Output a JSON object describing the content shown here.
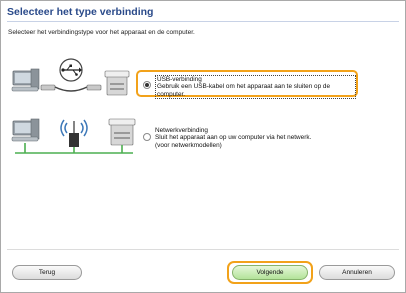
{
  "window": {
    "title": "Selecteer het type verbinding",
    "instruction": "Selecteer het verbindingstype voor het apparaat en de computer."
  },
  "options": [
    {
      "heading": "USB-verbinding",
      "description": "Gebruik een USB-kabel om het apparaat aan te sluiten op de computer.",
      "selected": true
    },
    {
      "heading": "Netwerkverbinding",
      "description_line1": "Sluit het apparaat aan op uw computer via het netwerk.",
      "description_line2": "(voor netwerkmodellen)",
      "selected": false
    }
  ],
  "buttons": {
    "back": "Terug",
    "next": "Volgende",
    "cancel": "Annuleren"
  },
  "colors": {
    "highlight": "#f2a21a",
    "title": "#2a4a8a",
    "next_button": "#b3e39a"
  },
  "icons": [
    "computer-icon",
    "usb-cable-icon",
    "usb-symbol-icon",
    "printer-icon",
    "wireless-router-icon",
    "wireless-signal-icon"
  ]
}
